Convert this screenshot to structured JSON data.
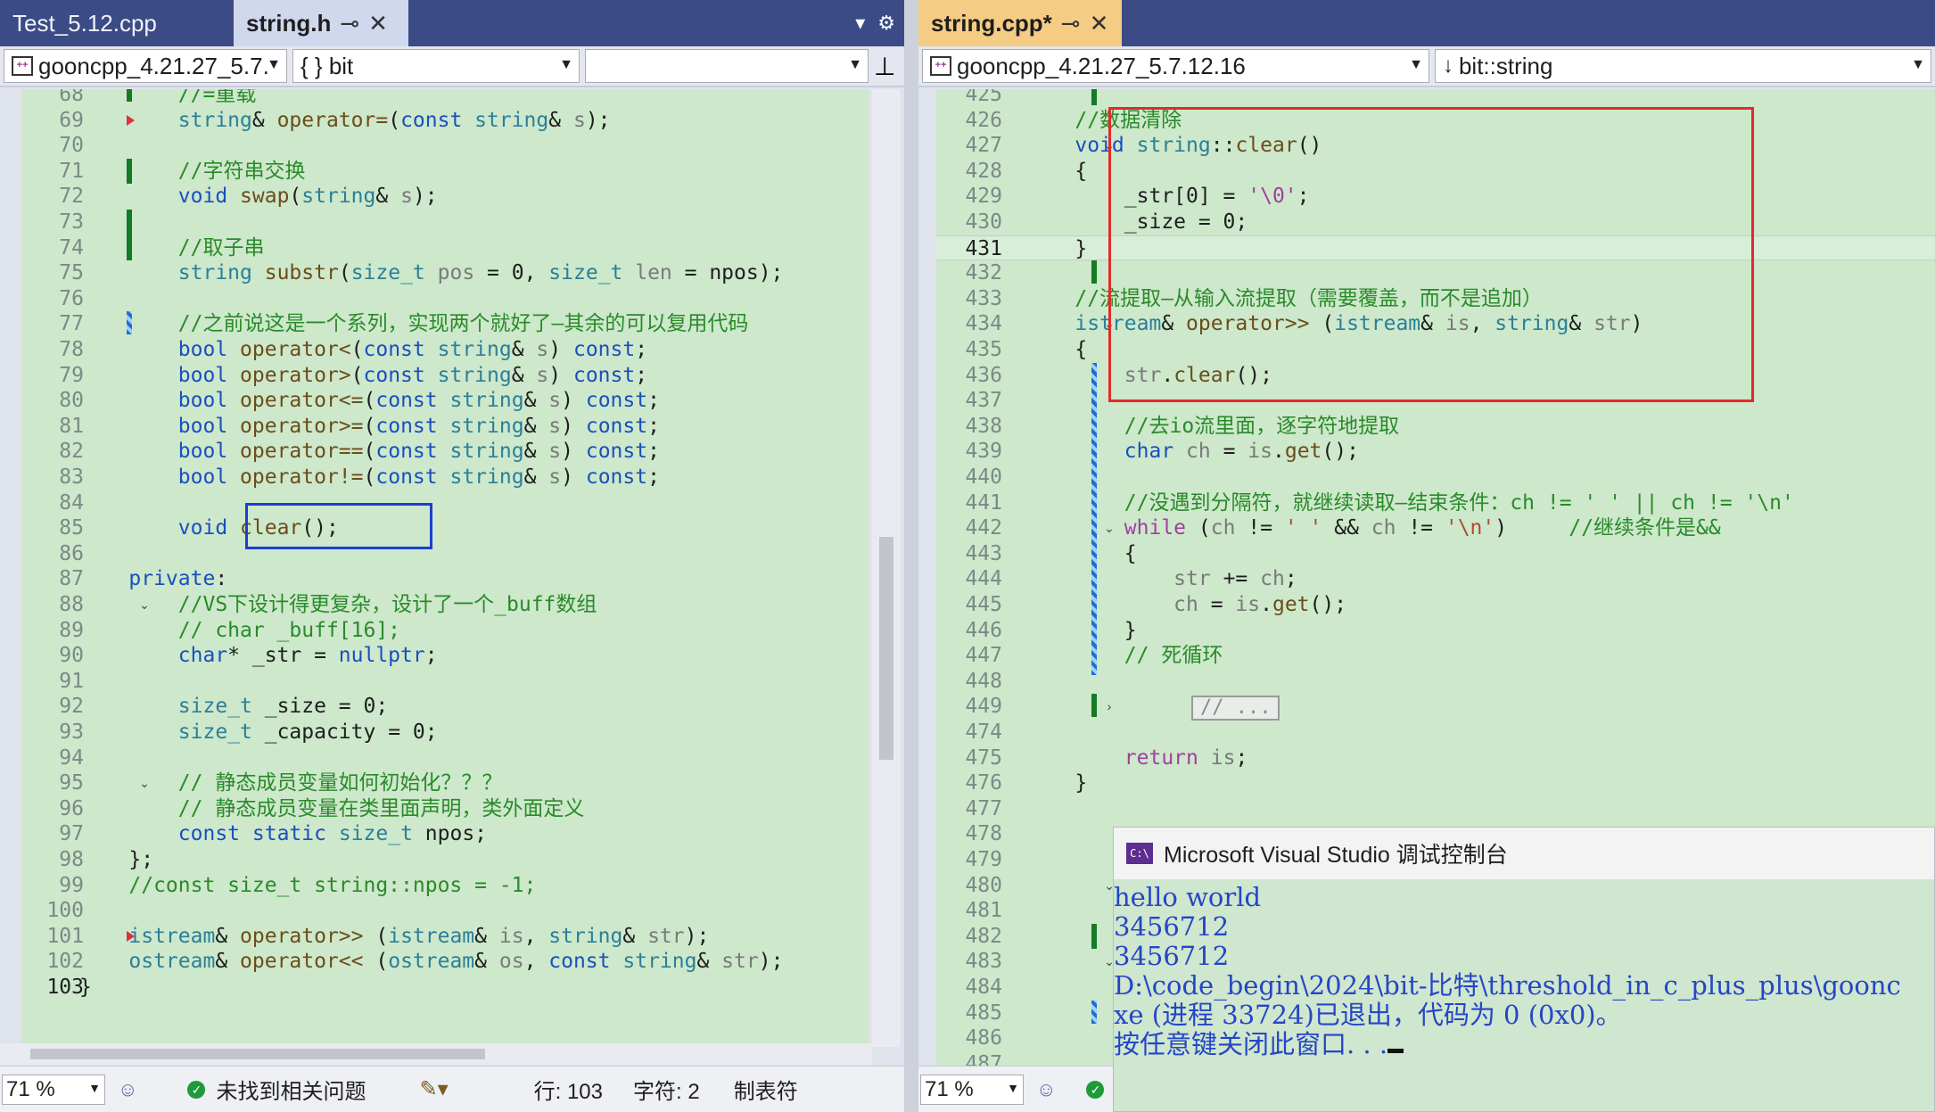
{
  "left": {
    "tabs": [
      {
        "label": "Test_5.12.cpp",
        "state": "inactive"
      },
      {
        "label": "string.h",
        "state": "active"
      }
    ],
    "nav": {
      "project": "gooncpp_4.21.27_5.7.",
      "scope": "{ } bit",
      "member": ""
    },
    "lines": [
      {
        "n": "68",
        "html": "<span class='cm'>        //=重载</span>"
      },
      {
        "n": "69",
        "html": "        <span class='ty'>string</span>&amp; <span class='fn'>operator=</span>(<span class='kw'>const</span> <span class='ty'>string</span>&amp; <span class='pr'>s</span>);"
      },
      {
        "n": "70",
        "html": ""
      },
      {
        "n": "71",
        "html": "<span class='cm'>        //字符串交换</span>"
      },
      {
        "n": "72",
        "html": "        <span class='kw'>void</span> <span class='fn'>swap</span>(<span class='ty'>string</span>&amp; <span class='pr'>s</span>);"
      },
      {
        "n": "73",
        "html": ""
      },
      {
        "n": "74",
        "html": "<span class='cm'>        //取子串</span>"
      },
      {
        "n": "75",
        "html": "        <span class='ty'>string</span> <span class='fn'>substr</span>(<span class='ty'>size_t</span> <span class='pr'>pos</span> = 0, <span class='ty'>size_t</span> <span class='pr'>len</span> = npos);"
      },
      {
        "n": "76",
        "html": ""
      },
      {
        "n": "77",
        "html": "<span class='cm'>        //之前说这是一个系列，实现两个就好了—其余的可以复用代码</span>"
      },
      {
        "n": "78",
        "html": "        <span class='kw'>bool</span> <span class='fn'>operator&lt;</span>(<span class='kw'>const</span> <span class='ty'>string</span>&amp; <span class='pr'>s</span>) <span class='kw'>const</span>;"
      },
      {
        "n": "79",
        "html": "        <span class='kw'>bool</span> <span class='fn'>operator&gt;</span>(<span class='kw'>const</span> <span class='ty'>string</span>&amp; <span class='pr'>s</span>) <span class='kw'>const</span>;"
      },
      {
        "n": "80",
        "html": "        <span class='kw'>bool</span> <span class='fn'>operator&lt;=</span>(<span class='kw'>const</span> <span class='ty'>string</span>&amp; <span class='pr'>s</span>) <span class='kw'>const</span>;"
      },
      {
        "n": "81",
        "html": "        <span class='kw'>bool</span> <span class='fn'>operator&gt;=</span>(<span class='kw'>const</span> <span class='ty'>string</span>&amp; <span class='pr'>s</span>) <span class='kw'>const</span>;"
      },
      {
        "n": "82",
        "html": "        <span class='kw'>bool</span> <span class='fn'>operator==</span>(<span class='kw'>const</span> <span class='ty'>string</span>&amp; <span class='pr'>s</span>) <span class='kw'>const</span>;"
      },
      {
        "n": "83",
        "html": "        <span class='kw'>bool</span> <span class='fn'>operator!=</span>(<span class='kw'>const</span> <span class='ty'>string</span>&amp; <span class='pr'>s</span>) <span class='kw'>const</span>;"
      },
      {
        "n": "84",
        "html": ""
      },
      {
        "n": "85",
        "html": "        <span class='kw'>void</span> <span class='fn'>clear</span>();"
      },
      {
        "n": "86",
        "html": ""
      },
      {
        "n": "87",
        "html": "    <span class='kw'>private</span>:"
      },
      {
        "n": "88",
        "html": "<span class='cm'>        //VS下设计得更复杂，设计了一个_buff数组</span>"
      },
      {
        "n": "89",
        "html": "<span class='cm'>        // char _buff[16];</span>"
      },
      {
        "n": "90",
        "html": "        <span class='kw'>char</span>* _str = <span class='kw'>nullptr</span>;"
      },
      {
        "n": "91",
        "html": ""
      },
      {
        "n": "92",
        "html": "        <span class='ty'>size_t</span> _size = 0;"
      },
      {
        "n": "93",
        "html": "        <span class='ty'>size_t</span> _capacity = 0;"
      },
      {
        "n": "94",
        "html": ""
      },
      {
        "n": "95",
        "html": "<span class='cm'>        // 静态成员变量如何初始化？？？</span>"
      },
      {
        "n": "96",
        "html": "<span class='cm'>        // 静态成员变量在类里面声明，类外面定义</span>"
      },
      {
        "n": "97",
        "html": "        <span class='kw'>const</span> <span class='kw'>static</span> <span class='ty'>size_t</span> npos;"
      },
      {
        "n": "98",
        "html": "    };"
      },
      {
        "n": "99",
        "html": "<span class='cm'>    //const size_t string::npos = -1;</span>"
      },
      {
        "n": "100",
        "html": ""
      },
      {
        "n": "101",
        "html": "    <span class='ty'>istream</span>&amp; <span class='fn'>operator&gt;&gt;</span> (<span class='ty'>istream</span>&amp; <span class='pr'>is</span>, <span class='ty'>string</span>&amp; <span class='pr'>str</span>);"
      },
      {
        "n": "102",
        "html": "    <span class='ty'>ostream</span>&amp; <span class='fn'>operator&lt;&lt;</span> (<span class='ty'>ostream</span>&amp; <span class='pr'>os</span>, <span class='kw'>const</span> <span class='ty'>string</span>&amp; <span class='pr'>str</span>);"
      },
      {
        "n": "103",
        "html": "}"
      }
    ],
    "current_line": "103",
    "status": {
      "zoom": "71 %",
      "issues": "未找到相关问题",
      "row": "行: 103",
      "col": "字符: 2",
      "tabs": "制表符"
    }
  },
  "right": {
    "tabs": [
      {
        "label": "string.cpp*",
        "state": "active"
      }
    ],
    "nav": {
      "project": "gooncpp_4.21.27_5.7.12.16",
      "scope": "bit::string"
    },
    "lines": [
      {
        "n": "425",
        "html": ""
      },
      {
        "n": "426",
        "html": "<span class='cm'>    //数据清除</span>"
      },
      {
        "n": "427",
        "html": "    <span class='kw'>void</span> <span class='ty'>string</span>::<span class='fn'>clear</span>()"
      },
      {
        "n": "428",
        "html": "    {"
      },
      {
        "n": "429",
        "html": "        _str[0] = <span class='ch'>'\\0'</span>;"
      },
      {
        "n": "430",
        "html": "        _size = 0;"
      },
      {
        "n": "431",
        "html": "    }"
      },
      {
        "n": "432",
        "html": ""
      },
      {
        "n": "433",
        "html": "<span class='cm'>    //流提取—从输入流提取（需要覆盖，而不是追加）</span>"
      },
      {
        "n": "434",
        "html": "    <span class='ty'>istream</span>&amp; <span class='fn'>operator&gt;&gt;</span> (<span class='ty'>istream</span>&amp; <span class='pr'>is</span>, <span class='ty'>string</span>&amp; <span class='pr'>str</span>)"
      },
      {
        "n": "435",
        "html": "    {"
      },
      {
        "n": "436",
        "html": "        <span class='pr'>str</span>.<span class='fn'>clear</span>();"
      },
      {
        "n": "437",
        "html": ""
      },
      {
        "n": "438",
        "html": "<span class='cm'>        //去io流里面，逐字符地提取</span>"
      },
      {
        "n": "439",
        "html": "        <span class='kw'>char</span> <span class='pr'>ch</span> = <span class='pr'>is</span>.<span class='fn'>get</span>();"
      },
      {
        "n": "440",
        "html": ""
      },
      {
        "n": "441",
        "html": "<span class='cm'>        //没遇到分隔符，就继续读取—结束条件：ch != ' ' || ch != '\\n'</span>"
      },
      {
        "n": "442",
        "html": "        <span class='ch'>while</span> (<span class='pr'>ch</span> != <span class='st'>' '</span> &amp;&amp; <span class='pr'>ch</span> != <span class='st'>'\\n'</span>)     <span class='cm'>//继续条件是&amp;&amp;</span>"
      },
      {
        "n": "443",
        "html": "        {"
      },
      {
        "n": "444",
        "html": "            <span class='pr'>str</span> += <span class='pr'>ch</span>;"
      },
      {
        "n": "445",
        "html": "            <span class='pr'>ch</span> = <span class='pr'>is</span>.<span class='fn'>get</span>();"
      },
      {
        "n": "446",
        "html": "        }"
      },
      {
        "n": "447",
        "html": "<span class='cm'>        // 死循环</span>"
      },
      {
        "n": "448",
        "html": ""
      },
      {
        "n": "449",
        "html": ""
      },
      {
        "n": "474",
        "html": ""
      },
      {
        "n": "475",
        "html": "        <span class='ch'>return</span> <span class='pr'>is</span>;"
      },
      {
        "n": "476",
        "html": "    }"
      },
      {
        "n": "477",
        "html": ""
      },
      {
        "n": "478",
        "html": ""
      },
      {
        "n": "479",
        "html": ""
      },
      {
        "n": "480",
        "html": ""
      },
      {
        "n": "481",
        "html": ""
      },
      {
        "n": "482",
        "html": ""
      },
      {
        "n": "483",
        "html": ""
      },
      {
        "n": "484",
        "html": ""
      },
      {
        "n": "485",
        "html": ""
      },
      {
        "n": "486",
        "html": ""
      },
      {
        "n": "487",
        "html": ""
      }
    ],
    "current_line": "431",
    "collapsed_label": "// ...",
    "status": {
      "zoom": "71 %"
    }
  },
  "console": {
    "title": "Microsoft Visual Studio 调试控制台",
    "icon": "C:\\",
    "lines": [
      "hello world",
      "3456712",
      "3456712",
      "",
      "D:\\code_begin\\2024\\bit-比特\\threshold_in_c_plus_plus\\goonc",
      "xe (进程 33724)已退出，代码为 0 (0x0)。",
      "按任意键关闭此窗口. . ."
    ]
  },
  "colors": {
    "editor_bg": "#cde8cb",
    "tab_bar": "#3b4b86",
    "active_tab": "#f5cc84",
    "highlight_red": "#e22a2a",
    "highlight_blue": "#1d3fd0",
    "console_text": "#2546c6"
  }
}
